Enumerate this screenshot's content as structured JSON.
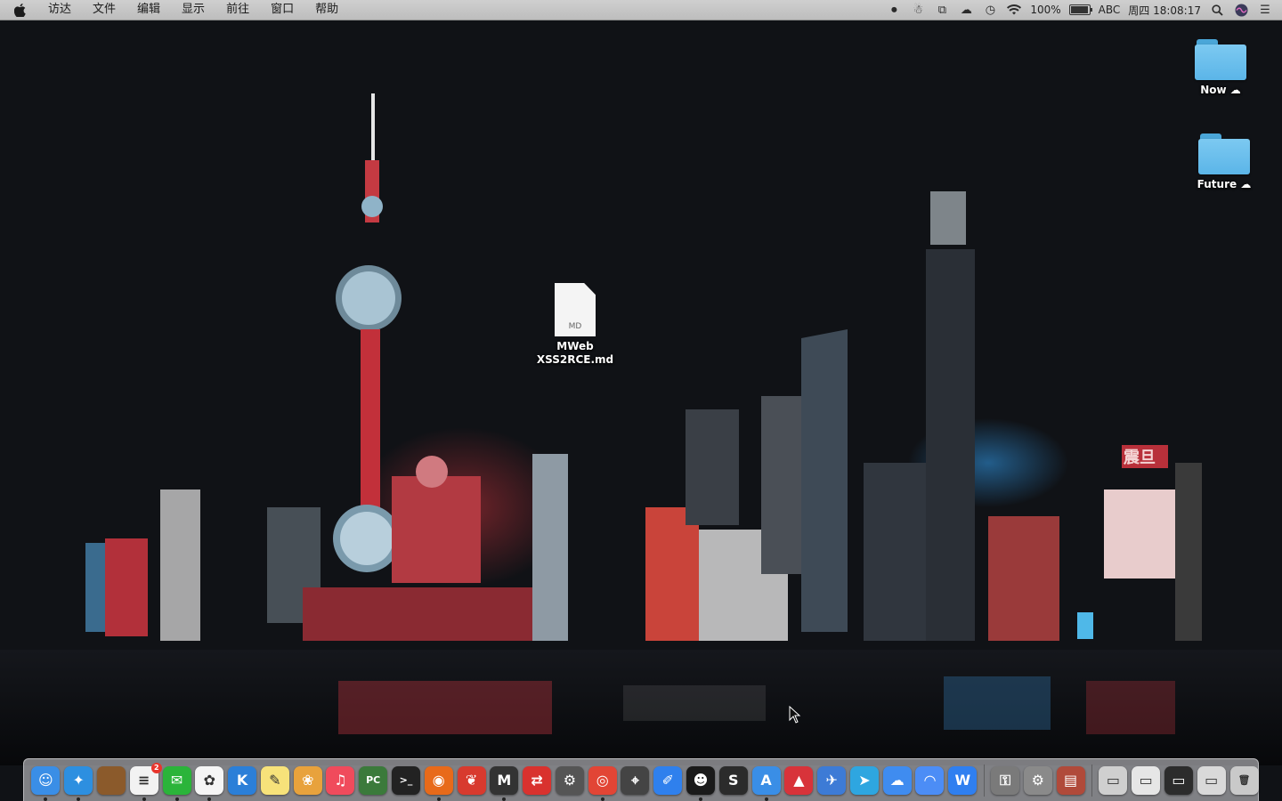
{
  "menubar": {
    "apple_icon": "apple-icon",
    "menus": [
      "访达",
      "文件",
      "编辑",
      "显示",
      "前往",
      "窗口",
      "帮助"
    ],
    "status": {
      "battery_percent": "100%",
      "input_method": "ABC",
      "datetime": "周四 18:08:17"
    }
  },
  "desktop": {
    "icons": [
      {
        "label": "Now",
        "kind": "folder",
        "cloud": "☁"
      },
      {
        "label": "Future",
        "kind": "folder",
        "cloud": "☁"
      },
      {
        "label_line1": "MWeb",
        "label_line2": "XSS2RCE.md",
        "kind": "document",
        "ext": "MD"
      }
    ]
  },
  "dock": {
    "apps": [
      {
        "name": "finder",
        "glyph": "☺",
        "color": "#3a8ee6",
        "running": true
      },
      {
        "name": "safari",
        "glyph": "✦",
        "color": "#2d8fe0",
        "running": true
      },
      {
        "name": "notebook",
        "glyph": "",
        "color": "#8b5a2b",
        "running": false
      },
      {
        "name": "reminders",
        "glyph": "≡",
        "color": "#f2f2f2",
        "running": true,
        "badge": "2"
      },
      {
        "name": "wechat",
        "glyph": "✉",
        "color": "#2bb43a",
        "running": true
      },
      {
        "name": "qq",
        "glyph": "✿",
        "color": "#f5f5f5",
        "running": true
      },
      {
        "name": "kiwi",
        "glyph": "K",
        "color": "#2b7fd8",
        "running": false
      },
      {
        "name": "notes",
        "glyph": "✎",
        "color": "#f7e27a",
        "running": false
      },
      {
        "name": "photos",
        "glyph": "❀",
        "color": "#e8a23c",
        "running": false
      },
      {
        "name": "music",
        "glyph": "♫",
        "color": "#f04b5c",
        "running": false
      },
      {
        "name": "pc-app",
        "glyph": "PC",
        "color": "#3b7a3b",
        "running": false
      },
      {
        "name": "terminal",
        "glyph": ">_",
        "color": "#222222",
        "running": false
      },
      {
        "name": "firefox",
        "glyph": "◉",
        "color": "#e86a1a",
        "running": true
      },
      {
        "name": "leaf",
        "glyph": "❦",
        "color": "#d83a2e",
        "running": false
      },
      {
        "name": "mweb",
        "glyph": "M",
        "color": "#333333",
        "running": true
      },
      {
        "name": "remote",
        "glyph": "⇄",
        "color": "#d9322e",
        "running": false
      },
      {
        "name": "system-info",
        "glyph": "⚙",
        "color": "#555555",
        "running": false
      },
      {
        "name": "chrome",
        "glyph": "◎",
        "color": "#e24535",
        "running": true
      },
      {
        "name": "compass",
        "glyph": "⌖",
        "color": "#444444",
        "running": false
      },
      {
        "name": "pen",
        "glyph": "✐",
        "color": "#2f80ed",
        "running": false
      },
      {
        "name": "mask",
        "glyph": "☻",
        "color": "#1a1a1a",
        "running": true
      },
      {
        "name": "sublime",
        "glyph": "S",
        "color": "#2b2b2b",
        "running": false
      },
      {
        "name": "app-store",
        "glyph": "A",
        "color": "#3a8ee6",
        "running": true
      },
      {
        "name": "canvas",
        "glyph": "▲",
        "color": "#d8333a",
        "running": false
      },
      {
        "name": "xcode",
        "glyph": "✈",
        "color": "#3d7bd6",
        "running": false
      },
      {
        "name": "telegram",
        "glyph": "➤",
        "color": "#2ea6e0",
        "running": false
      },
      {
        "name": "baidu-netdisk",
        "glyph": "☁",
        "color": "#3f8cf0",
        "running": false
      },
      {
        "name": "cloud-drive",
        "glyph": "◠",
        "color": "#4c8df6",
        "running": false
      },
      {
        "name": "wps",
        "glyph": "W",
        "color": "#2f7ff0",
        "running": false
      }
    ],
    "utilities": [
      {
        "name": "keychain",
        "glyph": "⚿",
        "color": "#7a7a7a"
      },
      {
        "name": "system-preferences",
        "glyph": "⚙",
        "color": "#8a8a8a"
      },
      {
        "name": "archive",
        "glyph": "▤",
        "color": "#b04a3a"
      }
    ],
    "documents": [
      {
        "name": "window-thumb-1",
        "glyph": "▭",
        "color": "#cfcfcf"
      },
      {
        "name": "window-thumb-2",
        "glyph": "▭",
        "color": "#e6e6e6"
      },
      {
        "name": "window-thumb-3",
        "glyph": "▭",
        "color": "#2c2c2c"
      },
      {
        "name": "window-thumb-4",
        "glyph": "▭",
        "color": "#d9d9d9"
      },
      {
        "name": "trash",
        "glyph": "🗑",
        "color": "#c9c9c9"
      }
    ]
  }
}
